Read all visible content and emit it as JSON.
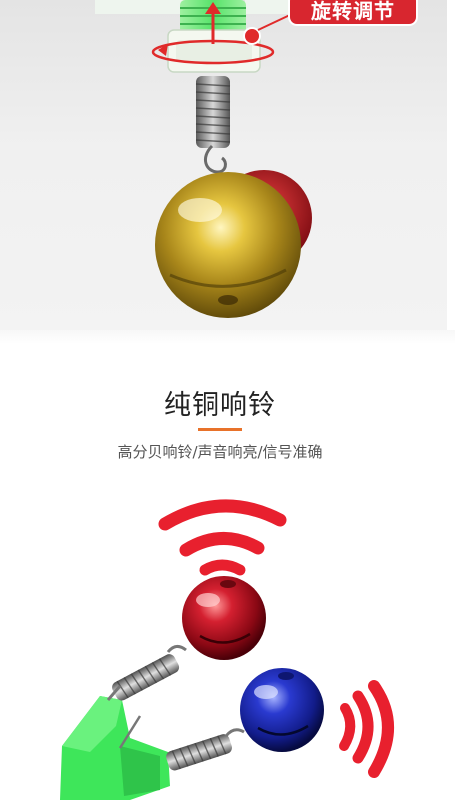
{
  "top_photo": {
    "badge_text": "旋转调节"
  },
  "feature": {
    "title": "纯铜响铃",
    "subtitle": "高分贝响铃/声音响亮/信号准确",
    "accent_color": "#e8722a",
    "sound_wave_color": "#e8202e"
  },
  "illustration": {
    "bell_colors": [
      "#c4a020",
      "#c0162a",
      "#1e2fb8"
    ],
    "clip_color": "#3ee65a"
  }
}
